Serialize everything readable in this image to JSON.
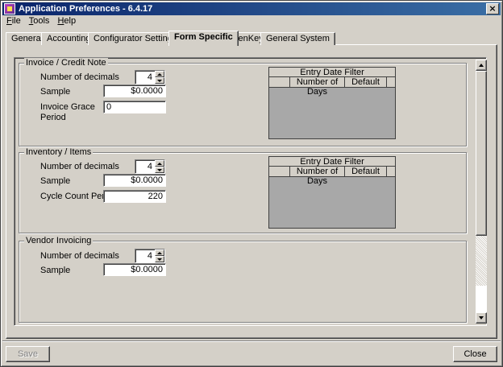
{
  "window": {
    "title": "Application Preferences - 6.4.17",
    "close_glyph": "×"
  },
  "menu": {
    "items": [
      {
        "underline": "F",
        "rest": "ile"
      },
      {
        "underline": "T",
        "rest": "ools"
      },
      {
        "underline": "H",
        "rest": "elp"
      }
    ]
  },
  "tabs": [
    {
      "label": "General"
    },
    {
      "label": "Accounting"
    },
    {
      "label": "Configurator Settings"
    },
    {
      "label": "Form Specific"
    },
    {
      "label": "GenKey"
    },
    {
      "label": "General System"
    }
  ],
  "sections": {
    "invoice": {
      "title": "Invoice / Credit Note",
      "decimals_label": "Number of decimals",
      "decimals_value": "4",
      "sample_label": "Sample",
      "sample_value": "$0.0000",
      "grace_label": "Invoice Grace Period",
      "grace_value": "0"
    },
    "inventory": {
      "title": "Inventory / Items",
      "decimals_label": "Number of decimals",
      "decimals_value": "4",
      "sample_label": "Sample",
      "sample_value": "$0.0000",
      "cycle_label": "Cycle Count Period",
      "cycle_value": "220"
    },
    "vendor": {
      "title": "Vendor Invoicing",
      "decimals_label": "Number of decimals",
      "decimals_value": "4",
      "sample_label": "Sample",
      "sample_value": "$0.0000"
    }
  },
  "grid": {
    "caption": "Entry Date Filter",
    "col_days": "Number of Days",
    "col_default": "Default"
  },
  "buttons": {
    "save": "Save",
    "close": "Close"
  }
}
